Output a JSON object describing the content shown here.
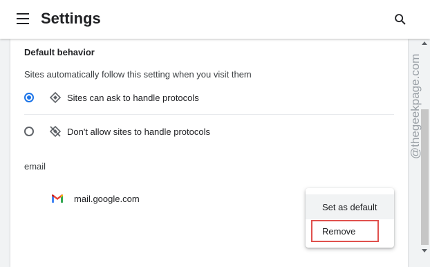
{
  "header": {
    "title": "Settings",
    "menu_icon": "hamburger-menu-icon",
    "search_icon": "search-icon"
  },
  "section": {
    "title": "Default behavior",
    "description": "Sites automatically follow this setting when you visit them",
    "options": [
      {
        "label": "Sites can ask to handle protocols",
        "icon": "protocol-handler-icon",
        "selected": true
      },
      {
        "label": "Don't allow sites to handle protocols",
        "icon": "protocol-handler-off-icon",
        "selected": false
      }
    ]
  },
  "group": {
    "label": "email",
    "site": {
      "name": "mail.google.com",
      "icon": "gmail-icon"
    }
  },
  "context_menu": {
    "set_default_label": "Set as default",
    "remove_label": "Remove"
  },
  "watermark": "@thegeekpage.com",
  "colors": {
    "accent": "#1a73e8",
    "highlight": "#e0504d"
  }
}
